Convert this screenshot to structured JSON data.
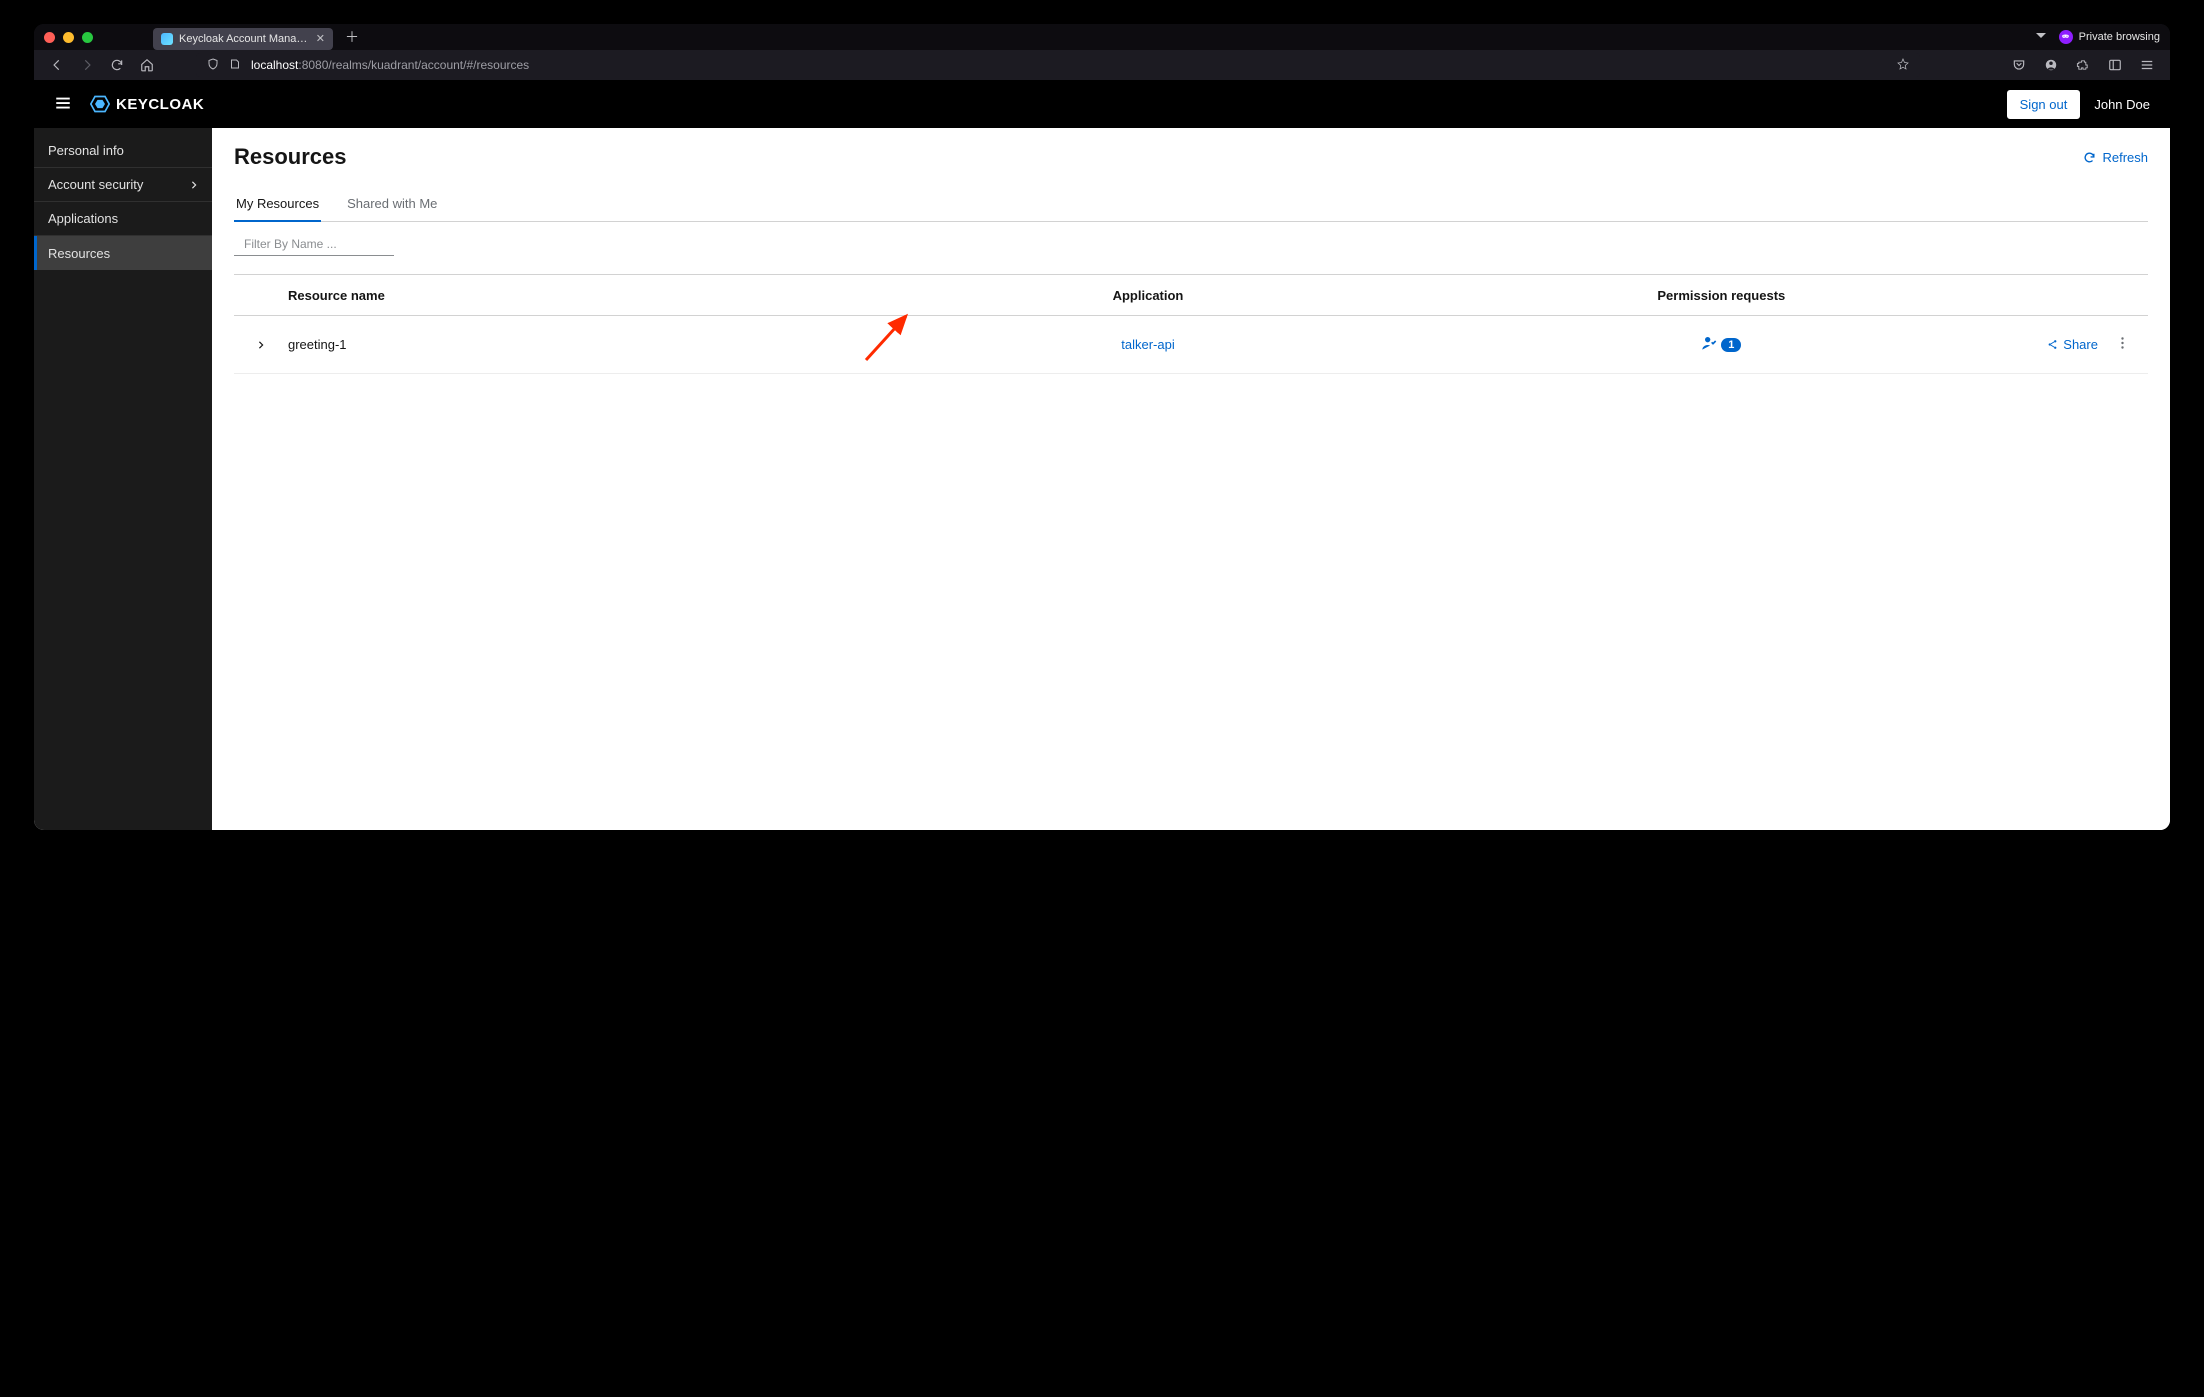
{
  "browser": {
    "tab_title": "Keycloak Account Management",
    "private_label": "Private browsing",
    "url_host": "localhost",
    "url_rest": ":8080/realms/kuadrant/account/#/resources"
  },
  "header": {
    "brand": "KEYCLOAK",
    "sign_out": "Sign out",
    "user": "John Doe"
  },
  "sidebar": {
    "personal_info": "Personal info",
    "account_security": "Account security",
    "applications": "Applications",
    "resources": "Resources"
  },
  "page": {
    "title": "Resources",
    "refresh": "Refresh",
    "tab_my": "My Resources",
    "tab_shared": "Shared with Me",
    "filter_placeholder": "Filter By Name ...",
    "col_resource": "Resource name",
    "col_app": "Application",
    "col_perm": "Permission requests",
    "share": "Share"
  },
  "rows": [
    {
      "name": "greeting-1",
      "application": "talker-api",
      "requests": "1"
    }
  ]
}
